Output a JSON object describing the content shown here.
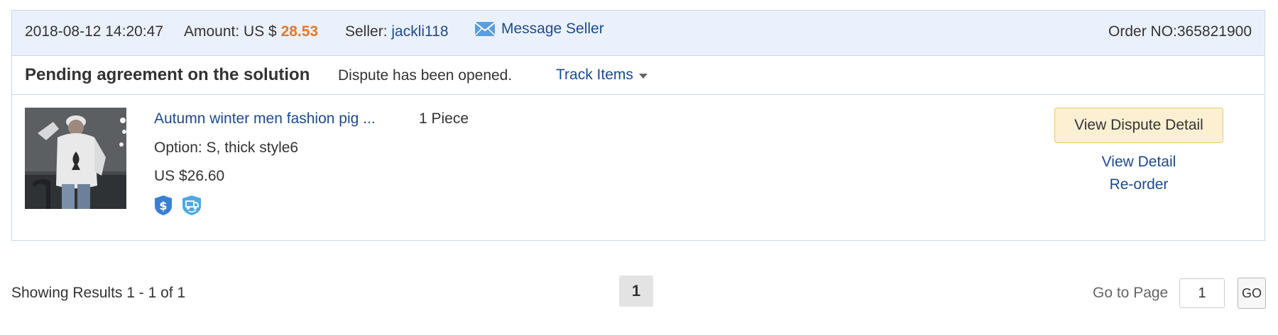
{
  "order": {
    "datetime": "2018-08-12 14:20:47",
    "amount_label": "Amount: US $ ",
    "amount_value": "28.53",
    "seller_label": "Seller: ",
    "seller_name": "jackli118",
    "message_seller": "Message Seller",
    "order_no": "Order NO:365821900"
  },
  "status": {
    "title": "Pending agreement on the solution",
    "description": "Dispute has been opened.",
    "track_items": "Track Items"
  },
  "item": {
    "title": "Autumn winter men fashion pig ...",
    "quantity": "1 Piece",
    "option": "Option: S, thick style6",
    "price": "US $26.60",
    "badges": [
      "dollar-shield-icon",
      "shipping-shield-icon"
    ]
  },
  "actions": {
    "view_dispute_detail": "View Dispute Detail",
    "view_detail": "View Detail",
    "reorder": "Re-order"
  },
  "pagination": {
    "summary": "Showing Results 1 - 1 of 1",
    "current_page": "1",
    "goto_label": "Go to Page",
    "goto_value": "1",
    "go_button": "GO"
  },
  "colors": {
    "link": "#1c4a91",
    "amount": "#e4782a",
    "header_bg": "#ebf1fc",
    "dispute_button_bg": "#fdf0d2"
  }
}
